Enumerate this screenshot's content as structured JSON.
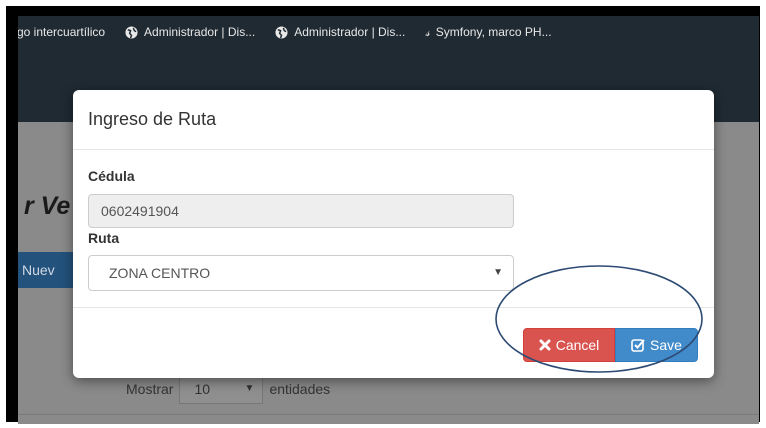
{
  "bookmarks": [
    {
      "label": "go intercuartílico",
      "icon": "none"
    },
    {
      "label": "Administrador | Dis...",
      "icon": "globe-icon"
    },
    {
      "label": "Administrador | Dis...",
      "icon": "globe-icon"
    },
    {
      "label": "Symfony, marco PH...",
      "icon": "symfony-icon"
    }
  ],
  "page": {
    "heading": "r Ve",
    "new_button": "Nuev",
    "show_prefix": "Mostrar",
    "show_value": "10",
    "show_suffix": "entidades"
  },
  "modal": {
    "title": "Ingreso de Ruta",
    "cedula_label": "Cédula",
    "cedula_value": "0602491904",
    "ruta_label": "Ruta",
    "ruta_value": "ZONA CENTRO",
    "cancel_label": "Cancel",
    "save_label": "Save"
  },
  "colors": {
    "cancel": "#d9534f",
    "save": "#428bca",
    "annotation": "#2c4a73"
  }
}
